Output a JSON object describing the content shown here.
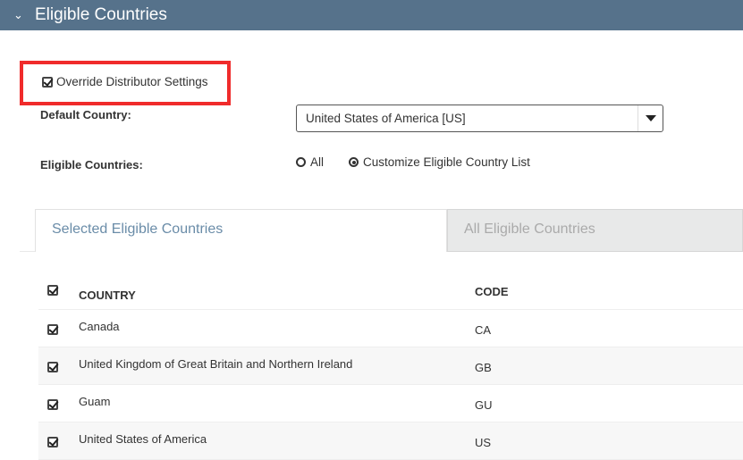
{
  "section": {
    "title": "Eligible Countries",
    "icon": "chevron-down-icon"
  },
  "override": {
    "label": "Override Distributor Settings",
    "checked": true
  },
  "default_country": {
    "label": "Default Country:",
    "value": "United States of America [US]"
  },
  "eligible": {
    "label": "Eligible Countries:",
    "options": [
      "All",
      "Customize Eligible Country List"
    ],
    "selected": "Customize Eligible Country List"
  },
  "tabs": [
    "Selected Eligible Countries",
    "All Eligible Countries"
  ],
  "table": {
    "headers": [
      "COUNTRY",
      "CODE"
    ],
    "rows": [
      {
        "country": "Canada",
        "code": "CA"
      },
      {
        "country": "United Kingdom of Great Britain and Northern Ireland",
        "code": "GB"
      },
      {
        "country": "Guam",
        "code": "GU"
      },
      {
        "country": "United States of America",
        "code": "US"
      }
    ]
  },
  "colors": {
    "header": "#56728b",
    "highlight": "#f02b2b",
    "active_tab": "#6a8ca8"
  }
}
